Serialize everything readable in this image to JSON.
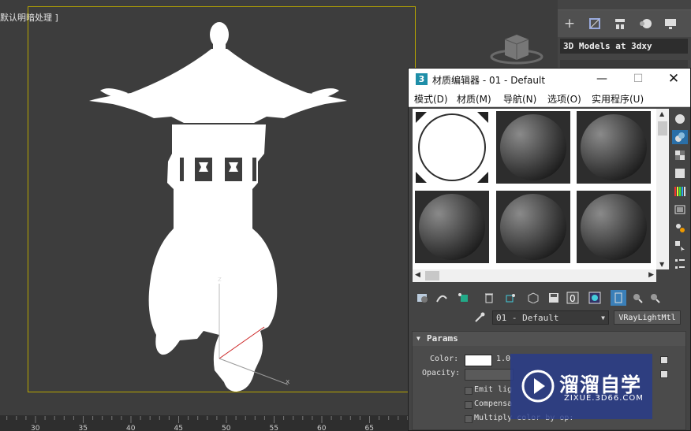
{
  "viewport": {
    "label": "[+] [默认明暗处理 ]",
    "label_visible": "默认明暗处理 ]",
    "axis_z": "z",
    "axis_x": "x"
  },
  "timeline": {
    "ticks": [
      "30",
      "35",
      "40",
      "45",
      "50",
      "55",
      "60",
      "65"
    ]
  },
  "command_panel": {
    "title": "3D Models at 3dxy",
    "icons": [
      "plus-icon",
      "modify-icon",
      "hierarchy-icon",
      "motion-icon",
      "display-icon"
    ]
  },
  "material_editor": {
    "app_icon": "3",
    "title": "材质编辑器 - 01 - Default",
    "menu": [
      "模式(D)",
      "材质(M)",
      "导航(N)",
      "选项(O)",
      "实用程序(U)"
    ],
    "material_name": "01 - Default",
    "material_type": "VRayLightMtl",
    "params": {
      "header": "Params",
      "color_label": "Color:",
      "color_value": "1.0",
      "opacity_label": "Opacity:",
      "emit_label": "Emit lig",
      "compensate_label": "Compensa",
      "multiply_label": "Multiply color by op:"
    }
  },
  "watermark": {
    "brand": "溜溜自学",
    "url": "ZIXUE.3D66.COM"
  },
  "colors": {
    "safe_frame": "#b8a700",
    "selection_blue": "#1e8ea8",
    "watermark_bg": "#283c8c"
  }
}
